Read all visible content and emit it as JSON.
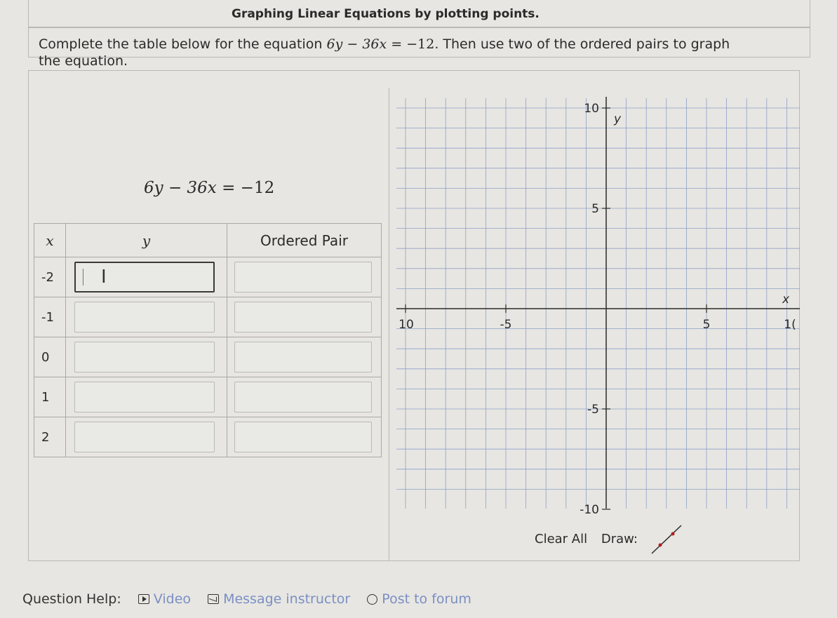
{
  "header": {
    "title": "Graphing Linear Equations by plotting points."
  },
  "prompt": {
    "before": "Complete the table below for the equation ",
    "equation_y": "6y",
    "minus1": " − ",
    "equation_x": "36x",
    "equals": " = ",
    "rhs": "−12",
    "after": ". Then use two of the ordered pairs to graph",
    "line2": "the equation."
  },
  "equation_display": {
    "left": "6y − 36x",
    "equals": " = ",
    "right": "−12"
  },
  "table": {
    "headers": {
      "x": "x",
      "y": "y",
      "pair": "Ordered Pair"
    },
    "rows": [
      {
        "x": "-2",
        "y": "",
        "pair": ""
      },
      {
        "x": "-1",
        "y": "",
        "pair": ""
      },
      {
        "x": "0",
        "y": "",
        "pair": ""
      },
      {
        "x": "1",
        "y": "",
        "pair": ""
      },
      {
        "x": "2",
        "y": "",
        "pair": ""
      }
    ]
  },
  "graph": {
    "x_axis_label": "x",
    "y_axis_label": "y",
    "x_ticks": [
      "10",
      "-5",
      "5",
      "1("
    ],
    "y_ticks": [
      "10",
      "5",
      "-5",
      "-10"
    ]
  },
  "controls": {
    "clear_all": "Clear All",
    "draw": "Draw:"
  },
  "help": {
    "label": "Question Help:",
    "video": "Video",
    "message": "Message instructor",
    "forum": "Post to forum"
  },
  "colors": {
    "link": "#7b8fc4",
    "grid": "#8ea0c8",
    "axis": "#2a2a2a",
    "draw_tool": "#b02020"
  }
}
